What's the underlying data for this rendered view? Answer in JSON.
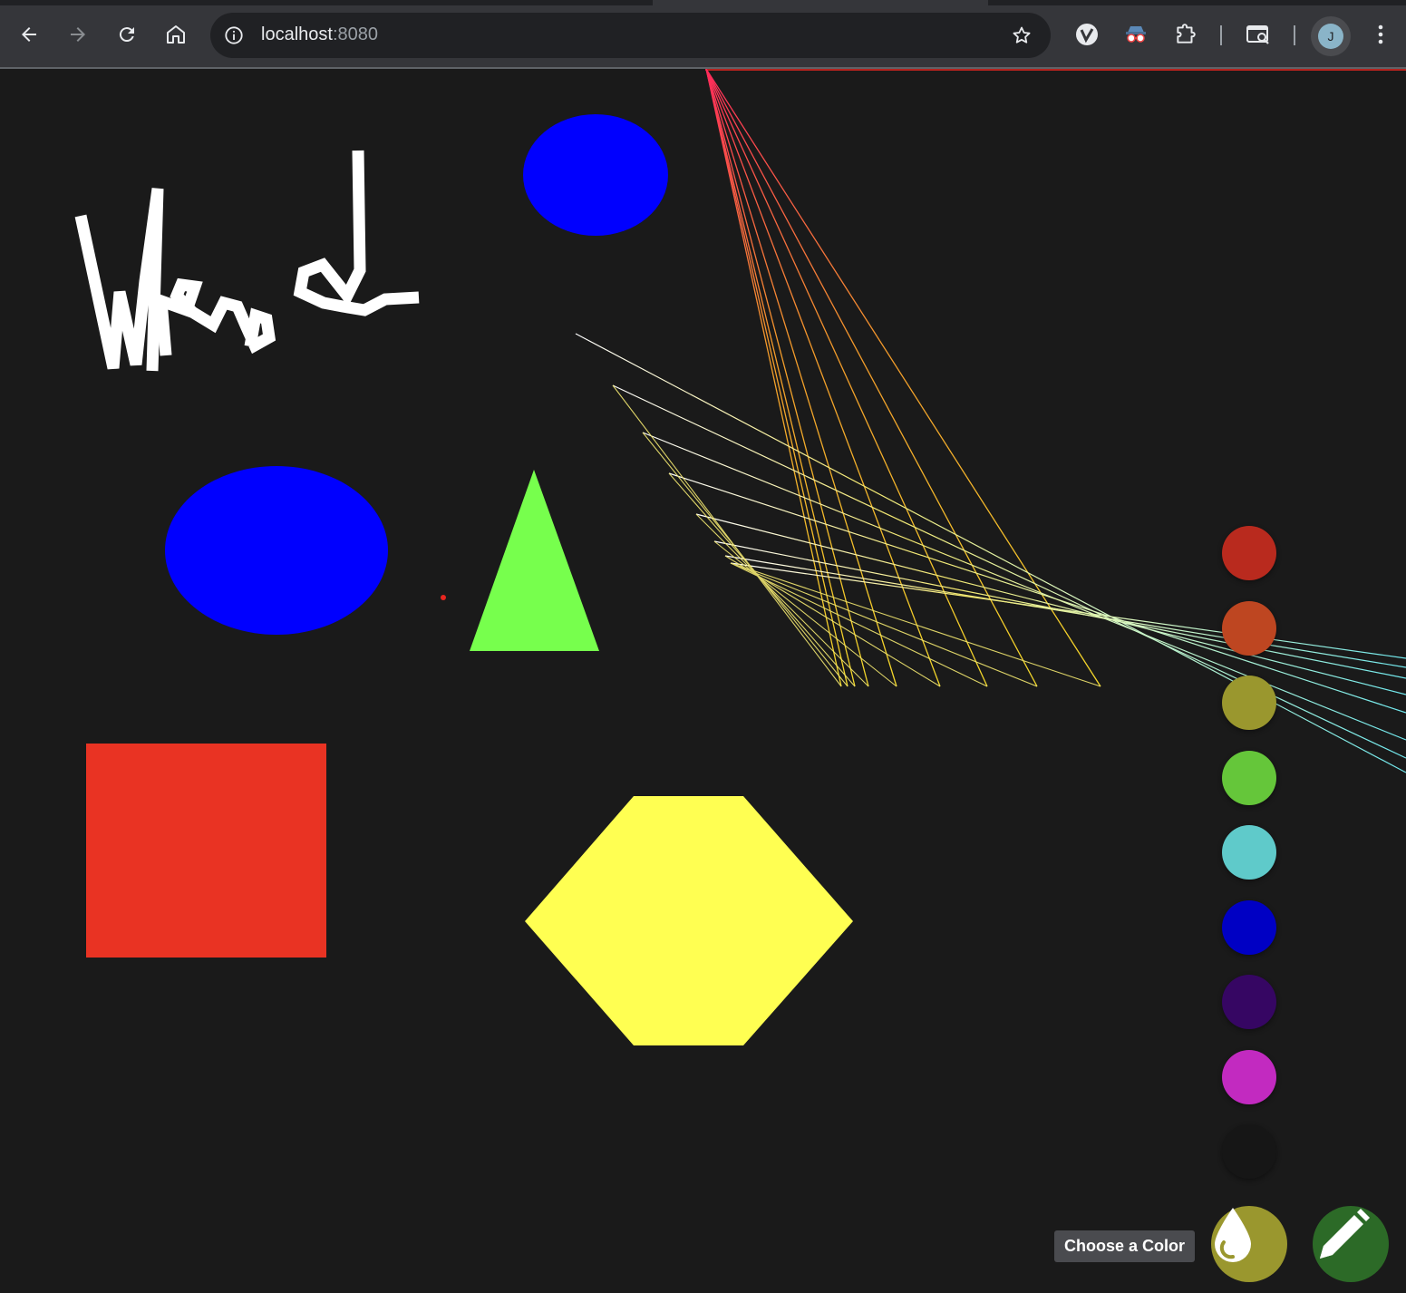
{
  "browser": {
    "url_host": "localhost",
    "url_port": ":8080",
    "avatar_letter": "J",
    "icons": [
      "back-icon",
      "forward-icon",
      "reload-icon",
      "home-icon",
      "site-info-icon",
      "bookmark-star-icon",
      "extension-v-icon",
      "extension-spy-icon",
      "extensions-puzzle-icon",
      "tab-search-icon",
      "menu-kebab-icon"
    ]
  },
  "drawing": {
    "background": "#1a1a1a",
    "shapes": [
      {
        "name": "handwritten-webgl-scribble",
        "color": "#ffffff"
      },
      {
        "name": "blue-ellipse-top",
        "color": "#0000ff"
      },
      {
        "name": "blue-ellipse-left",
        "color": "#0000ff"
      },
      {
        "name": "green-triangle",
        "color": "#77ff4d"
      },
      {
        "name": "red-dot",
        "color": "#e8261f"
      },
      {
        "name": "red-square",
        "color": "#e93323"
      },
      {
        "name": "yellow-hexagon",
        "color": "#ffff52"
      },
      {
        "name": "gradient-line-fan",
        "colors": [
          "#ff2a5a",
          "#f3d82a",
          "#ffffff",
          "#6fe8ee"
        ]
      }
    ]
  },
  "palette": {
    "swatches": [
      {
        "name": "red",
        "color": "#b92a1e"
      },
      {
        "name": "orange",
        "color": "#be4621"
      },
      {
        "name": "olive",
        "color": "#9a972e"
      },
      {
        "name": "green",
        "color": "#65c63a"
      },
      {
        "name": "cyan",
        "color": "#5fcaca"
      },
      {
        "name": "blue",
        "color": "#0000c4"
      },
      {
        "name": "indigo",
        "color": "#360663"
      },
      {
        "name": "magenta",
        "color": "#c22ac0"
      },
      {
        "name": "black",
        "color": "#161616"
      }
    ]
  },
  "controls": {
    "tooltip": "Choose a Color",
    "color_button_bg": "#9a972e",
    "pencil_button_bg": "#2c6a27"
  }
}
